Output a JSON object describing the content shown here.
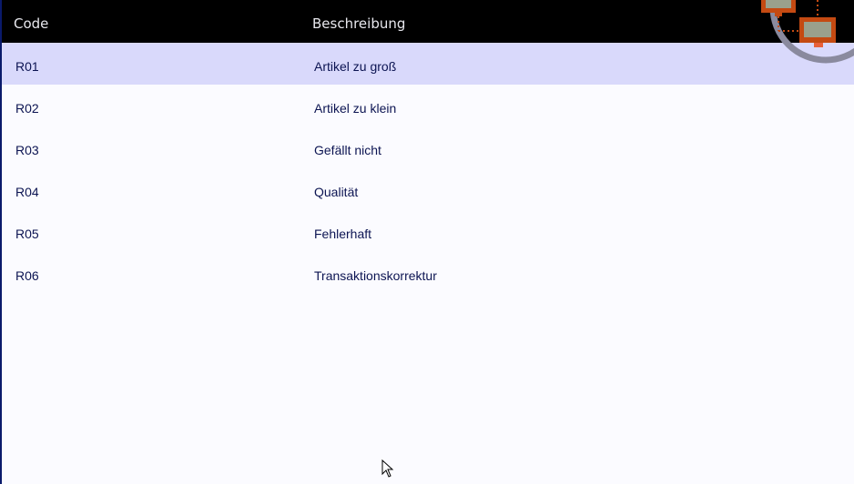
{
  "table": {
    "headers": {
      "code": "Code",
      "description": "Beschreibung"
    },
    "selected_index": 0,
    "rows": [
      {
        "code": "R01",
        "description": "Artikel zu groß"
      },
      {
        "code": "R02",
        "description": "Artikel zu klein"
      },
      {
        "code": "R03",
        "description": "Gefällt nicht"
      },
      {
        "code": "R04",
        "description": "Qualität"
      },
      {
        "code": "R05",
        "description": "Fehlerhaft"
      },
      {
        "code": "R06",
        "description": "Transaktionskorrektur"
      }
    ]
  },
  "colors": {
    "header_bg": "#000000",
    "selected_row_bg": "#d9d9fb",
    "text": "#0c1452",
    "page_bg": "#fbfbff"
  },
  "icons": {
    "logo": "network-computers-icon",
    "cursor": "mouse-pointer-icon"
  }
}
